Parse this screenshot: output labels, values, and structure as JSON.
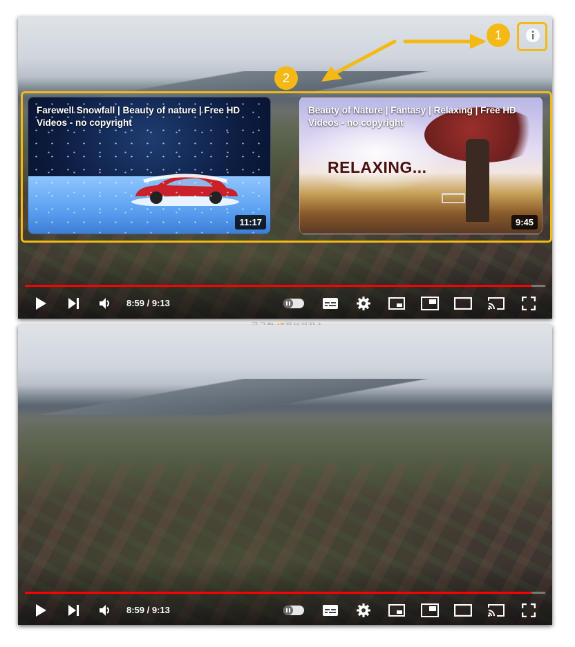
{
  "player_top": {
    "time_display": "8:59 / 9:13",
    "progress_fraction": 0.974,
    "end_cards": [
      {
        "title": "Farewell Snowfall | Beauty of nature | Free HD Videos - no copyright",
        "duration": "11:17"
      },
      {
        "title": "Beauty of Nature | Fantasy | Relaxing | Free HD Videos - no copyright",
        "duration": "9:45",
        "overlay_text": "RELAXING..."
      }
    ],
    "annotation_badges": [
      "1",
      "2"
    ],
    "highlight_color": "#f5b915"
  },
  "player_bottom": {
    "time_display": "8:59 / 9:13",
    "progress_fraction": 0.974
  },
  "watermark": {
    "prefix": "궁금한 ",
    "accent": "IT",
    "suffix": "정보저장소"
  },
  "controls": [
    "play-icon",
    "next-icon",
    "volume-icon",
    "autoplay-toggle",
    "subtitles-icon",
    "settings-icon",
    "miniplayer-icon",
    "theater-icon",
    "fullscreen-window-icon",
    "cast-icon",
    "fullscreen-icon"
  ],
  "colors": {
    "progress": "#ff0000",
    "accent": "#f5b915"
  }
}
